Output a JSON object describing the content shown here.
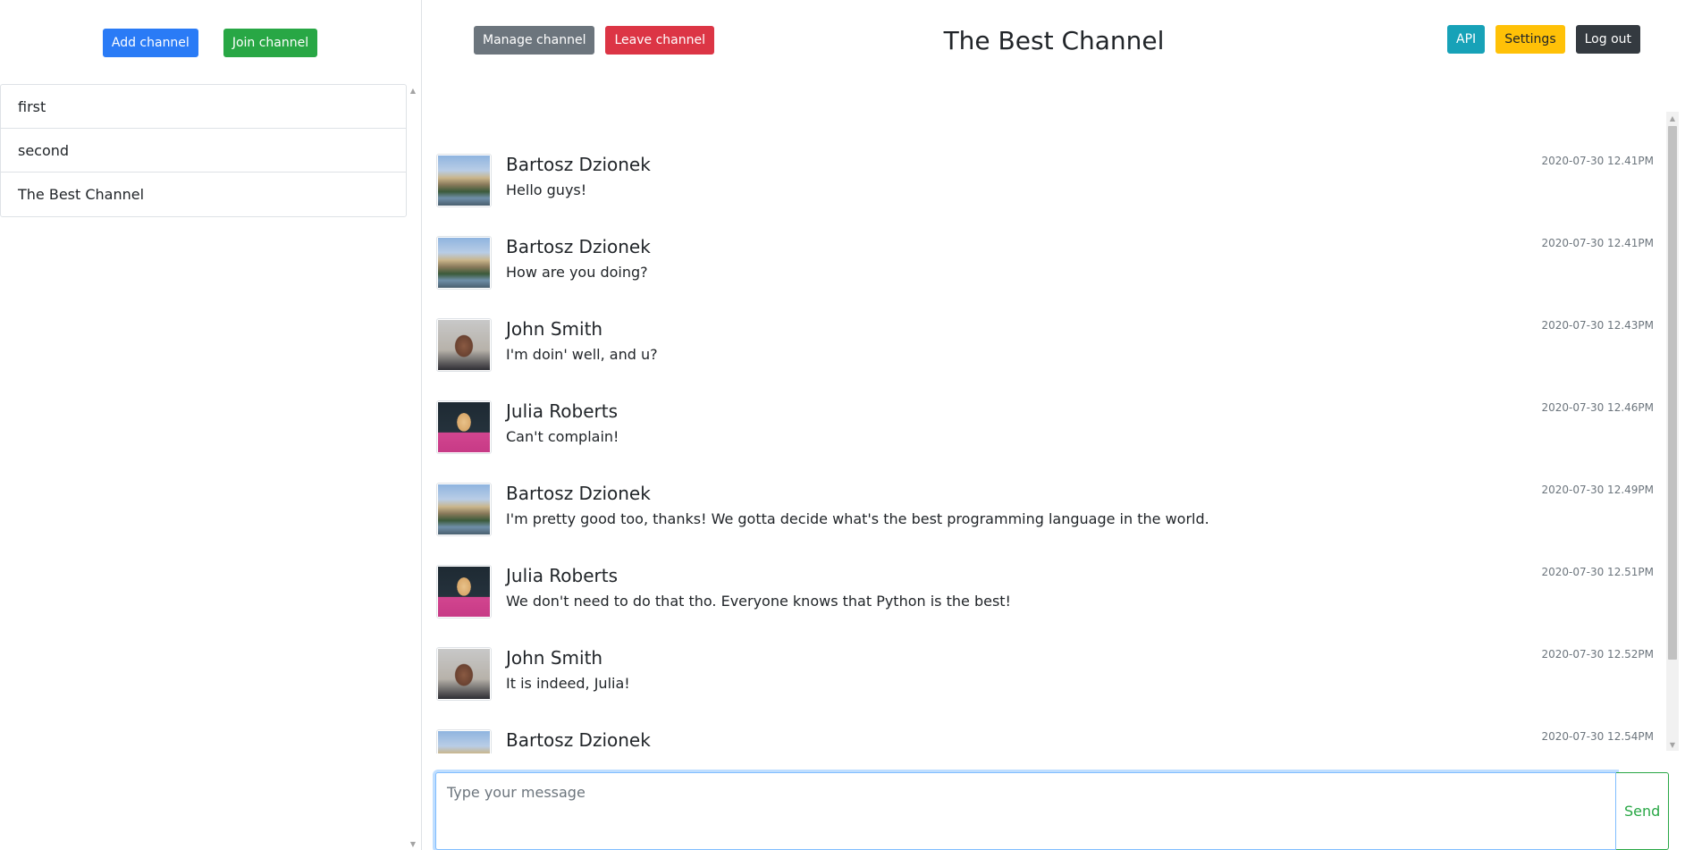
{
  "sidebar": {
    "add_channel_label": "Add channel",
    "join_channel_label": "Join channel",
    "channels": [
      {
        "label": "first"
      },
      {
        "label": "second"
      },
      {
        "label": "The Best Channel"
      }
    ]
  },
  "header": {
    "manage_channel_label": "Manage channel",
    "leave_channel_label": "Leave channel",
    "channel_title": "The Best Channel",
    "api_label": "API",
    "settings_label": "Settings",
    "logout_label": "Log out"
  },
  "messages": [
    {
      "author": "Bartosz Dzionek",
      "text": "Hello guys!",
      "time": "2020-07-30 12.41PM",
      "avatar": "castle-photo"
    },
    {
      "author": "Bartosz Dzionek",
      "text": "How are you doing?",
      "time": "2020-07-30 12.41PM",
      "avatar": "castle-photo"
    },
    {
      "author": "John Smith",
      "text": "I'm doin' well, and u?",
      "time": "2020-07-30 12.43PM",
      "avatar": "man-portrait"
    },
    {
      "author": "Julia Roberts",
      "text": "Can't complain!",
      "time": "2020-07-30 12.46PM",
      "avatar": "woman-portrait"
    },
    {
      "author": "Bartosz Dzionek",
      "text": "I'm pretty good too, thanks! We gotta decide what's the best programming language in the world.",
      "time": "2020-07-30 12.49PM",
      "avatar": "castle-photo"
    },
    {
      "author": "Julia Roberts",
      "text": "We don't need to do that tho. Everyone knows that Python is the best!",
      "time": "2020-07-30 12.51PM",
      "avatar": "woman-portrait"
    },
    {
      "author": "John Smith",
      "text": "It is indeed, Julia!",
      "time": "2020-07-30 12.52PM",
      "avatar": "man-portrait"
    },
    {
      "author": "Bartosz Dzionek",
      "text": "",
      "time": "2020-07-30 12.54PM",
      "avatar": "castle-photo"
    }
  ],
  "composer": {
    "placeholder": "Type your message",
    "value": "",
    "send_label": "Send"
  },
  "colors": {
    "primary": "#2a7bf6",
    "success": "#28a745",
    "secondary": "#6c757d",
    "danger": "#dc3545",
    "info": "#17a2b8",
    "warning": "#ffc107",
    "dark": "#343a40"
  }
}
